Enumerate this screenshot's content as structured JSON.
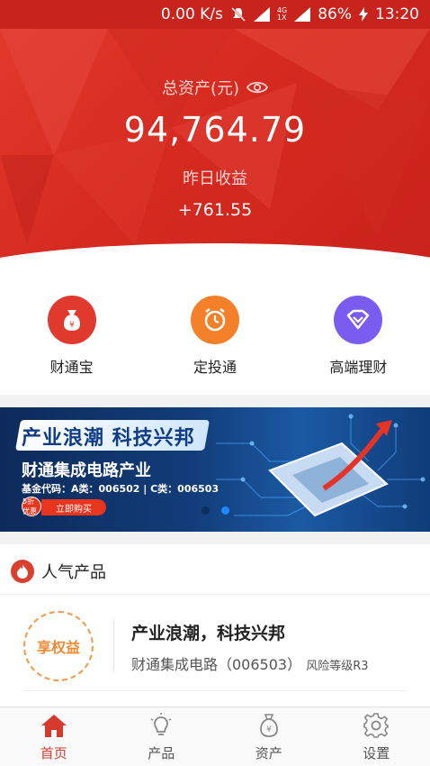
{
  "status_bar": {
    "speed": "0.00 K/s",
    "net_top": "4G",
    "net_bottom": "1X",
    "battery": "86%",
    "time": "13:20"
  },
  "hero": {
    "total_label": "总资产(元)",
    "total_value": "94,764.79",
    "yesterday_label": "昨日收益",
    "yesterday_value": "+761.55"
  },
  "shortcuts": [
    {
      "label": "财通宝",
      "icon": "money-bag-icon",
      "color": "#e0392e"
    },
    {
      "label": "定投通",
      "icon": "alarm-clock-icon",
      "color": "#f4802a"
    },
    {
      "label": "高端理财",
      "icon": "diamond-icon",
      "color": "#7a5cf0"
    }
  ],
  "banner": {
    "title": "产业浪潮 科技兴邦",
    "subtitle": "财通集成电路产业",
    "code": "基金代码：A类：006502 | C类：006503",
    "badge": "5折优惠",
    "buy_label": "立即购买",
    "page_count": 2,
    "active_page": 2
  },
  "section": {
    "title": "人气产品"
  },
  "product": {
    "ring_label": "享权益",
    "name": "产业浪潮，科技兴邦",
    "desc": "财通集成电路（006503）",
    "risk": "风险等级R3"
  },
  "tabbar": [
    {
      "label": "首页",
      "icon": "home-icon",
      "active": true
    },
    {
      "label": "产品",
      "icon": "lightbulb-icon",
      "active": false
    },
    {
      "label": "资产",
      "icon": "money-bag-outline-icon",
      "active": false
    },
    {
      "label": "设置",
      "icon": "gear-icon",
      "active": false
    }
  ],
  "colors": {
    "brand_red": "#d63a2e",
    "orange": "#f4802a",
    "purple": "#7a5cf0"
  }
}
